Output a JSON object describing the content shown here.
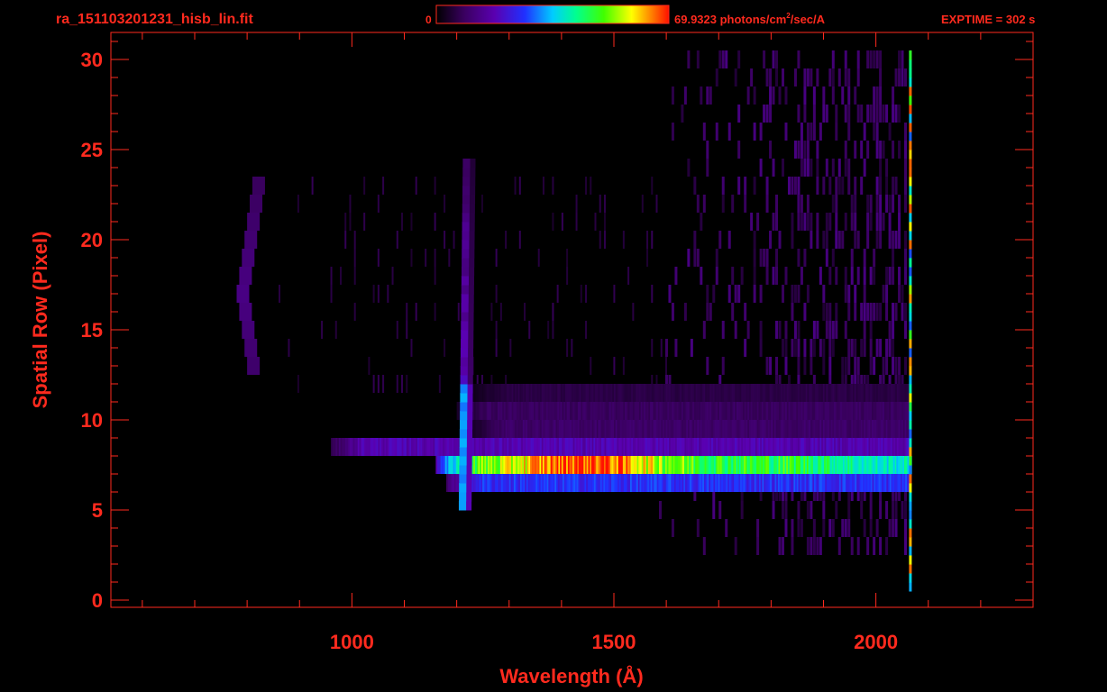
{
  "header": {
    "filename": "ra_151103201231_hisb_lin.fit",
    "colorbar_min": "0",
    "colorbar_max_prefix": "69.9323 photons/cm",
    "colorbar_max_exp": "2",
    "colorbar_max_suffix": "/sec/A",
    "exptime": "EXPTIME = 302 s"
  },
  "colors": {
    "text": "#ff2a1e",
    "axis": "#ff2a1e",
    "background": "#000000",
    "colorbar": [
      "#000000",
      "#3a0060",
      "#5a00b0",
      "#2030ff",
      "#00ccff",
      "#00ff90",
      "#40ff00",
      "#ffff00",
      "#ff8800",
      "#ff1000"
    ]
  },
  "chart_data": {
    "type": "heatmap",
    "title": "ra_151103201231_hisb_lin.fit",
    "xlabel": "Wavelength (Å)",
    "ylabel": "Spatial Row (Pixel)",
    "xlim": [
      540,
      2300
    ],
    "ylim": [
      -0.4,
      31.5
    ],
    "xticks": [
      1000,
      1500,
      2000
    ],
    "xtick_labels": [
      "1000",
      "1500",
      "2000"
    ],
    "yticks": [
      0,
      5,
      10,
      15,
      20,
      25,
      30
    ],
    "ytick_labels": [
      "0",
      "5",
      "10",
      "15",
      "20",
      "25",
      "30"
    ],
    "colorscale": {
      "min": 0,
      "max": 69.9323,
      "units": "photons/cm²/sec/A"
    },
    "exptime_s": 302,
    "grid": false,
    "rows": [
      {
        "row": 7.5,
        "x_start": 1160,
        "x_end": 2065,
        "intensity": 0.62,
        "peak_x": 1440
      },
      {
        "row": 6.5,
        "x_start": 1180,
        "x_end": 2065,
        "intensity": 0.32
      },
      {
        "row": 8.5,
        "x_start": 960,
        "x_end": 2060,
        "intensity": 0.22
      },
      {
        "row": 9.5,
        "x_start": 1230,
        "x_end": 2060,
        "intensity": 0.12
      },
      {
        "row": 10.5,
        "x_start": 1200,
        "x_end": 2060,
        "intensity": 0.11
      },
      {
        "row": 11.5,
        "x_start": 1230,
        "x_end": 2060,
        "intensity": 0.08
      }
    ],
    "features": [
      {
        "label": "Lyman-alpha line",
        "x": 1216,
        "rows": [
          5,
          24
        ]
      },
      {
        "label": "detector edge",
        "x": 2065,
        "rows": [
          0.5,
          30
        ]
      },
      {
        "label": "faint arc",
        "x": 810,
        "rows": [
          13,
          23
        ]
      }
    ]
  }
}
